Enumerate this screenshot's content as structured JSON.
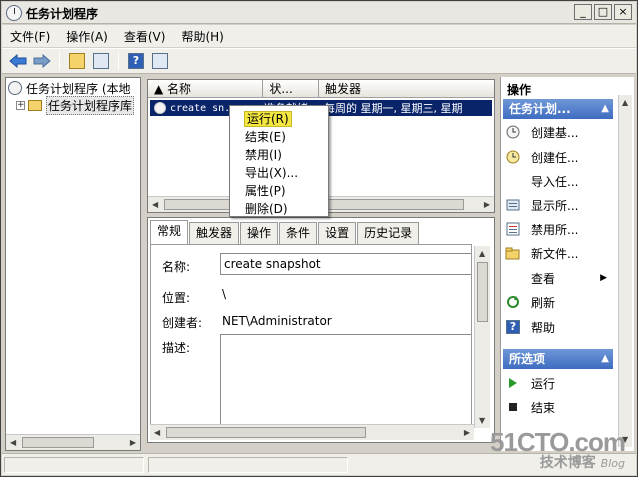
{
  "window": {
    "title": "任务计划程序",
    "buttons": {
      "minimize": "_",
      "maximize": "□",
      "close": "×"
    }
  },
  "menubar": [
    "文件(F)",
    "操作(A)",
    "查看(V)",
    "帮助(H)"
  ],
  "toolbar": {
    "icons": [
      "back-arrow-icon",
      "forward-arrow-icon",
      "up-folder-icon",
      "show-hide-tree-icon",
      "help-icon",
      "show-hide-action-pane-icon"
    ]
  },
  "tree": {
    "root": "任务计划程序 (本地",
    "library": "任务计划程序库"
  },
  "tasklist": {
    "columns": [
      "名称",
      "状...",
      "触发器"
    ],
    "rows": [
      {
        "name": "create sn...",
        "status": "准备就绪",
        "trigger": "每周的 星期一, 星期三, 星期"
      }
    ]
  },
  "context_menu": [
    "运行(R)",
    "结束(E)",
    "禁用(I)",
    "导出(X)...",
    "属性(P)",
    "删除(D)"
  ],
  "details": {
    "tabs": [
      "常规",
      "触发器",
      "操作",
      "条件",
      "设置",
      "历史记录"
    ],
    "fields": {
      "name_label": "名称:",
      "name_value": "create snapshot",
      "location_label": "位置:",
      "location_value": "\\",
      "author_label": "创建者:",
      "author_value": "NET\\Administrator",
      "description_label": "描述:"
    }
  },
  "actions": {
    "title": "操作",
    "section1": "任务计划...",
    "items1": [
      {
        "label": "创建基...",
        "icon": "create-basic-task-icon"
      },
      {
        "label": "创建任...",
        "icon": "create-task-icon"
      },
      {
        "label": "导入任...",
        "icon": "none"
      },
      {
        "label": "显示所...",
        "icon": "display-running-tasks-icon"
      },
      {
        "label": "禁用所...",
        "icon": "disable-history-icon"
      },
      {
        "label": "新文件...",
        "icon": "new-folder-icon"
      },
      {
        "label": "查看",
        "icon": "none"
      },
      {
        "label": "刷新",
        "icon": "refresh-icon"
      },
      {
        "label": "帮助",
        "icon": "help-icon"
      }
    ],
    "section2": "所选项",
    "items2": [
      {
        "label": "运行",
        "icon": "run-icon"
      },
      {
        "label": "结束",
        "icon": "stop-icon"
      }
    ]
  },
  "watermark": {
    "big": "51CTO.com",
    "small": "技术博客",
    "tag": "Blog"
  },
  "colors": {
    "selection": "#0a246a",
    "section_header": "#3e6cc0",
    "menu_highlight": "#f4e742"
  }
}
